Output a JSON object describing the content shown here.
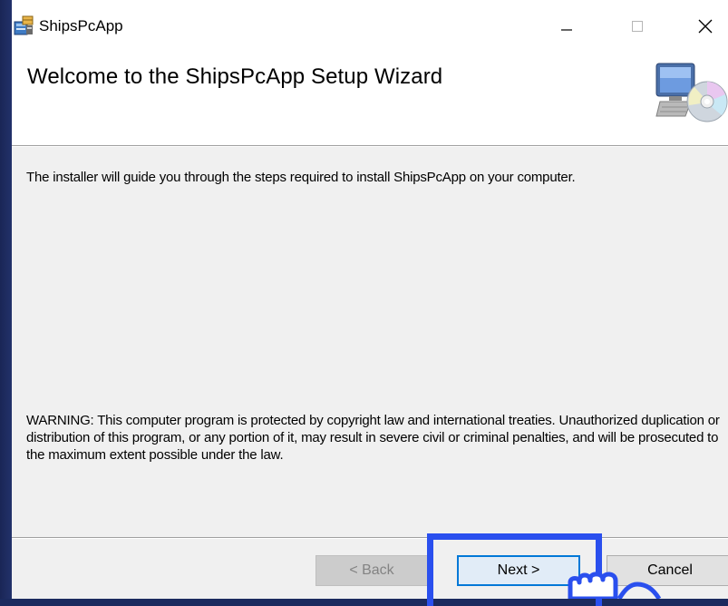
{
  "window": {
    "title": "ShipsPcApp",
    "controls": {
      "minimize": "—",
      "maximize": "☐",
      "close": "✕"
    }
  },
  "header": {
    "title": "Welcome to the ShipsPcApp Setup Wizard",
    "art_icon": "computer-with-cd-icon"
  },
  "body": {
    "intro": "The installer will guide you through the steps required to install ShipsPcApp on your computer.",
    "warning": "WARNING: This computer program is protected by copyright law and international treaties. Unauthorized duplication or distribution of this program, or any portion of it, may result in severe civil or criminal penalties, and will be prosecuted to the maximum extent possible under the law."
  },
  "buttons": {
    "back": "< Back",
    "next": "Next >",
    "cancel": "Cancel"
  },
  "icons": {
    "app": "installer-box-icon",
    "pointer": "hand-pointer-icon"
  },
  "colors": {
    "desktop": "#1b2a5e",
    "highlight": "#2a4fee",
    "focus_border": "#0078d7"
  }
}
